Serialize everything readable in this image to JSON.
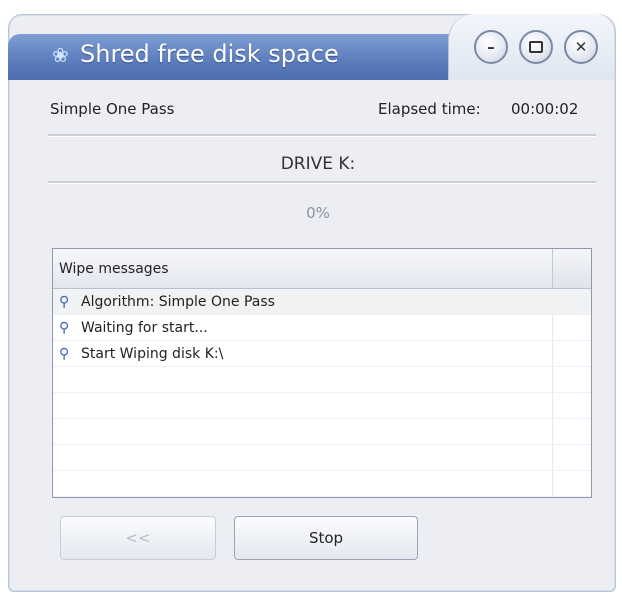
{
  "window": {
    "title": "Shred free disk space",
    "buttons": [
      "minimize",
      "maximize",
      "close"
    ]
  },
  "status": {
    "algorithm": "Simple One Pass",
    "elapsed_label": "Elapsed time:",
    "elapsed_value": "00:00:02",
    "drive": "DRIVE K:",
    "progress_text": "0%",
    "progress": 0
  },
  "messages": {
    "header": "Wipe messages",
    "items": [
      "Algorithm: Simple One Pass",
      "Waiting for start...",
      "Start Wiping disk K:\\"
    ]
  },
  "buttons": {
    "back_label": "<<",
    "stop_label": "Stop"
  },
  "icons": {
    "title": "shred-app-icon",
    "message": "info-key-icon"
  },
  "colors": {
    "title_bar": "#5e7fbe",
    "window_bg": "#eceef4"
  }
}
